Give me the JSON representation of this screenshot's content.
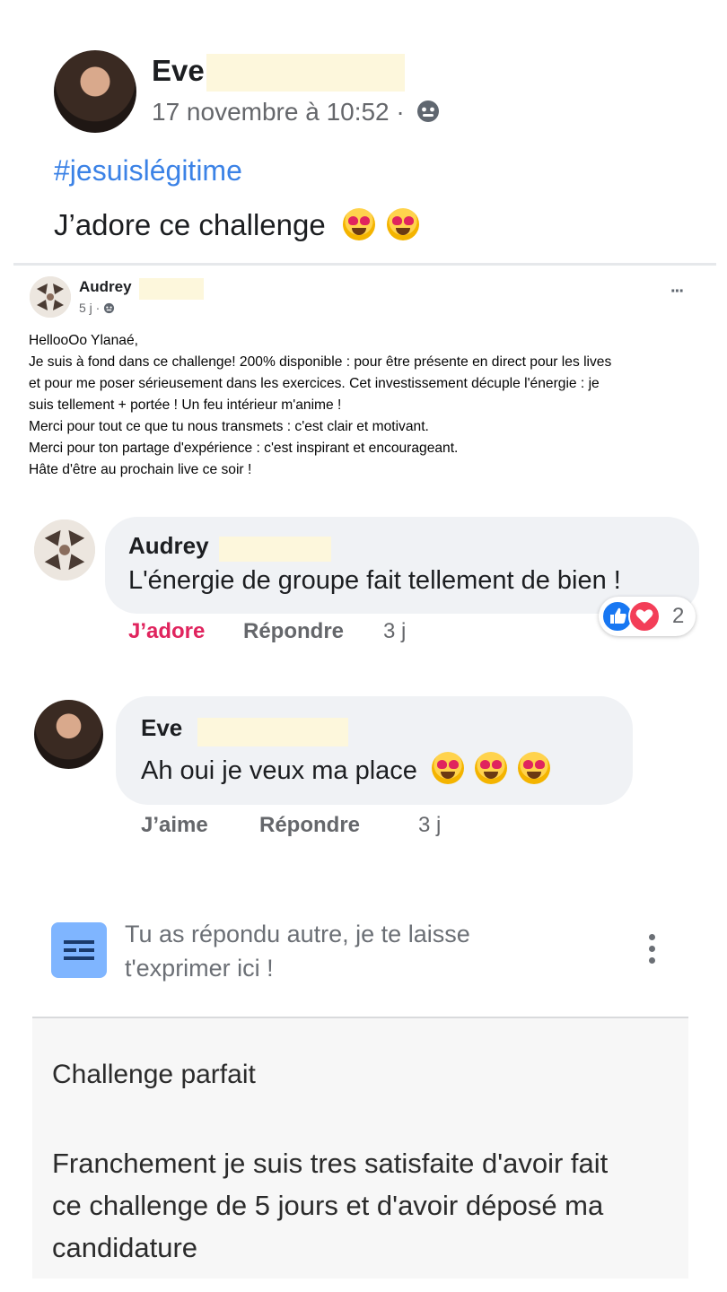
{
  "post": {
    "author": "Eve",
    "meta": "17 novembre à 10:52 ·",
    "hashtag": "#jesuislégitime",
    "text": "J’adore ce challenge"
  },
  "shared": {
    "author": "Audrey",
    "meta": "5 j ·",
    "more": "···",
    "lines": [
      "HellooOo Ylanaé,",
      "Je suis à fond dans ce challenge! 200% disponible : pour être présente en direct pour les lives",
      "et pour me poser sérieusement dans les exercices. Cet investissement décuple l'énergie : je",
      "suis tellement + portée ! Un feu intérieur m'anime !",
      "Merci pour tout ce que tu nous transmets : c'est clair et motivant.",
      "Merci pour ton partage d'expérience : c'est inspirant et encourageant.",
      "Hâte d'être au prochain live ce soir !"
    ]
  },
  "comments": [
    {
      "author": "Audrey",
      "text": "L'énergie de groupe fait tellement de bien !",
      "react_label": "J’adore",
      "reply_label": "Répondre",
      "time": "3 j",
      "reaction_count": "2"
    },
    {
      "author": "Eve",
      "text": "Ah oui je veux ma place",
      "react_label": "J’aime",
      "reply_label": "Répondre",
      "time": "3 j"
    }
  ],
  "form": {
    "question": "Tu as répondu autre, je te laisse t'exprimer ici !",
    "answer_title": "Challenge parfait",
    "answer_body": "Franchement je suis tres satisfaite d'avoir fait ce challenge de 5 jours et d'avoir déposé ma candidature"
  },
  "colors": {
    "hashtag": "#3b82e6",
    "love_action": "#e0245e",
    "like_blue": "#1877f2",
    "love_red": "#f33e58",
    "form_icon": "#7fb5ff"
  }
}
